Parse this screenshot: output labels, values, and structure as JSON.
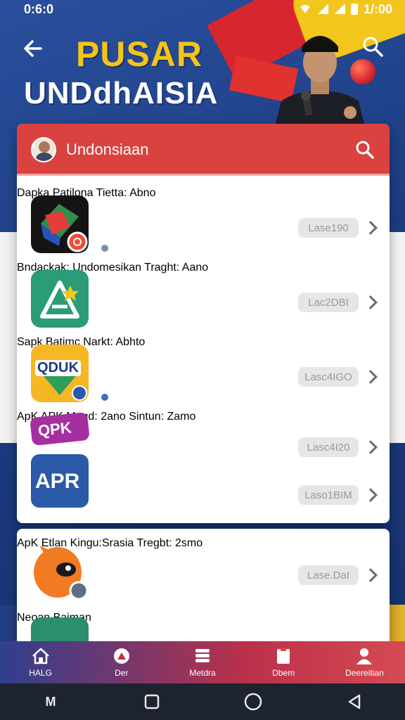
{
  "status_bar": {
    "time": "0:6:0",
    "right_time": "1/:00"
  },
  "header": {
    "title_top": "PUSAR",
    "title_bottom": "UNDdhAISIA"
  },
  "card": {
    "header_label": "Undonsiaan",
    "items": [
      {
        "name": "Dapka Patilona",
        "sub": "Tietta: Abno",
        "badge": "Lase190"
      },
      {
        "name": "Bndackak: Undomesikan",
        "sub": "Traght: Aano",
        "badge": "Lac2DBI"
      },
      {
        "name": "Sapk Batimc",
        "sub": "Narkt: Abhto",
        "badge": "Lasc4IGO"
      },
      {
        "name": "ApK APK",
        "sub": "Megd: 2ano",
        "badge": "Lasc4I20"
      },
      {
        "name": "",
        "sub": "Sintun: Zamo",
        "badge": "Laso1BIM"
      }
    ],
    "apr_icon_text": "APR",
    "qpk_icon_text": "QPK",
    "qduk_icon_text": "QDUK"
  },
  "card2": {
    "items": [
      {
        "name": "ApK Etlan Kingu:Srasia",
        "sub": "Tregbt: 2smo",
        "badge": "Lase.DaI"
      },
      {
        "name": "Neoan Baiman",
        "sub": "",
        "badge": ""
      }
    ]
  },
  "bottom_nav": [
    {
      "label": "HALG",
      "icon": "home-icon"
    },
    {
      "label": "Der",
      "icon": "compass-icon"
    },
    {
      "label": "Metdra",
      "icon": "stack-icon"
    },
    {
      "label": "Dbem",
      "icon": "doc-icon"
    },
    {
      "label": "Deereitian",
      "icon": "person-icon"
    }
  ],
  "system_nav": {
    "left_label": "M"
  },
  "colors": {
    "accent_red": "#d9423f",
    "accent_yellow": "#f5c417",
    "navy": "#1d3f86"
  }
}
